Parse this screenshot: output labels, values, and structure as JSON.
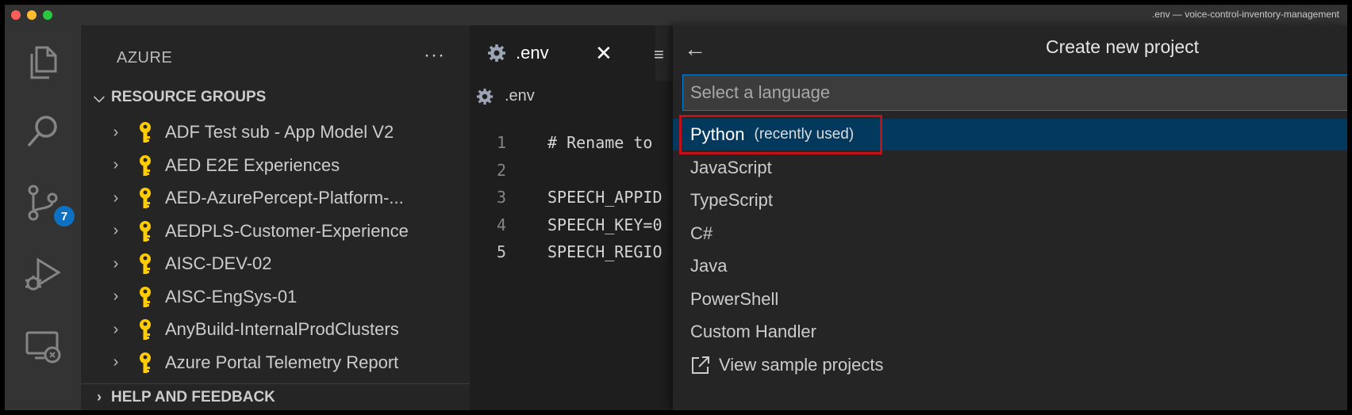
{
  "window": {
    "title": ".env — voice-control-inventory-management",
    "traffic_lights": [
      "close-button",
      "minimize-button",
      "maximize-button"
    ]
  },
  "activity_bar": {
    "items": [
      {
        "icon": "files-icon"
      },
      {
        "icon": "search-icon"
      },
      {
        "icon": "source-control-icon",
        "badge": "7"
      },
      {
        "icon": "run-debug-icon"
      },
      {
        "icon": "remote-explorer-icon"
      }
    ]
  },
  "sidebar": {
    "title": "AZURE",
    "more_label": "···",
    "section_title": "RESOURCE GROUPS",
    "resource_groups": [
      "ADF Test sub - App Model V2",
      "AED E2E Experiences",
      "AED-AzurePercept-Platform-...",
      "AEDPLS-Customer-Experience",
      "AISC-DEV-02",
      "AISC-EngSys-01",
      "AnyBuild-InternalProdClusters",
      "Azure Portal Telemetry Report"
    ],
    "help_section": "HELP AND FEEDBACK"
  },
  "editor": {
    "active_tab": ".env",
    "close_label": "✕",
    "second_tab_icon": "≡",
    "breadcrumb": ".env",
    "lines": [
      {
        "number": "1",
        "text": "# Rename to"
      },
      {
        "number": "2",
        "text": ""
      },
      {
        "number": "3",
        "text": "SPEECH_APPID"
      },
      {
        "number": "4",
        "text": "SPEECH_KEY=0"
      },
      {
        "number": "5",
        "text": "SPEECH_REGIO"
      }
    ]
  },
  "quick_pick": {
    "back_label": "←",
    "title": "Create new project",
    "placeholder": "Select a language",
    "options": [
      {
        "label": "Python",
        "description": "(recently used)",
        "selected": true
      },
      {
        "label": "JavaScript"
      },
      {
        "label": "TypeScript"
      },
      {
        "label": "C#"
      },
      {
        "label": "Java"
      },
      {
        "label": "PowerShell"
      },
      {
        "label": "Custom Handler"
      },
      {
        "label": "View sample projects",
        "icon": "link-external-icon"
      }
    ]
  },
  "colors": {
    "accent": "#007fd4",
    "selection": "#04395e",
    "highlight_box": "#c0101a",
    "key_icon": "#ffcc00",
    "badge": "#0e70c0"
  }
}
